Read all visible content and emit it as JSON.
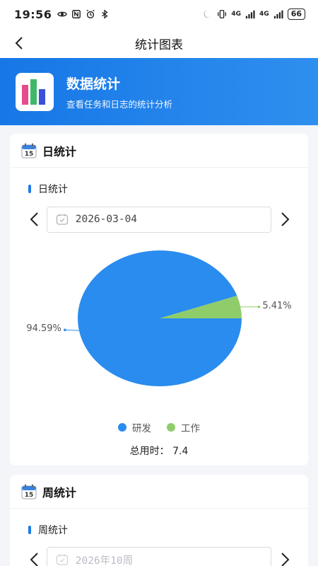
{
  "status_bar": {
    "time": "19:56",
    "battery": "66",
    "signal_label_1": "4G",
    "signal_label_2": "4G"
  },
  "app_bar": {
    "title": "统计图表"
  },
  "banner": {
    "title": "数据统计",
    "subtitle": "查看任务和日志的统计分析"
  },
  "day_card": {
    "title": "日统计",
    "calendar_day": "15",
    "section_label": "日统计",
    "date": "2026-03-04",
    "total_label": "总用时：",
    "total_value": "7.4"
  },
  "week_card": {
    "title": "周统计",
    "calendar_day": "15",
    "section_label": "周统计",
    "period": "2026年10周"
  },
  "chart_data": {
    "type": "pie",
    "categories": [
      "研发",
      "工作"
    ],
    "values": [
      94.59,
      5.41
    ],
    "labels": [
      "94.59%",
      "5.41%"
    ],
    "colors": [
      "#2a8cee",
      "#8fcd6a"
    ],
    "legend_position": "bottom"
  }
}
